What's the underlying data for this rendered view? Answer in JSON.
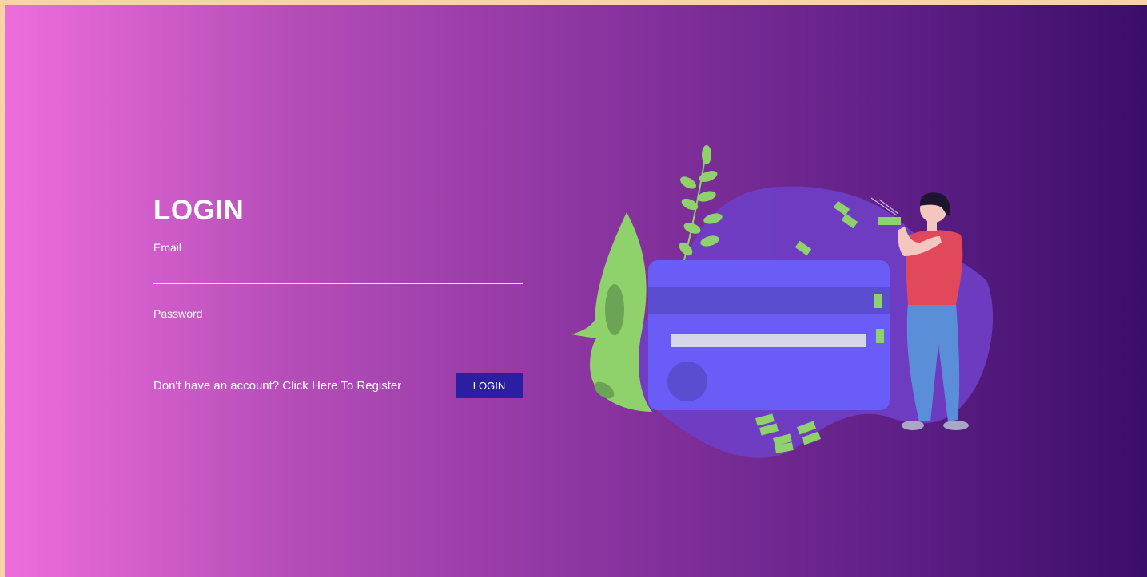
{
  "login": {
    "title": "LOGIN",
    "email_label": "Email",
    "email_value": "",
    "password_label": "Password",
    "password_value": "",
    "register_text": "Don't have an account? Click Here To Register",
    "submit_label": "LOGIN"
  },
  "colors": {
    "gradient_start": "#ee6ddd",
    "gradient_end": "#3b0e6a",
    "page_border": "#f8d3a6",
    "button": "#2a1fa0",
    "card": "#6a5cf6",
    "card_stripe": "#5a4dd0",
    "blob": "#6f3fc6",
    "leaf": "#8fd16a",
    "shirt": "#e1485a",
    "jeans": "#5b8ed8"
  },
  "icons": {
    "illustration": "credit-card-payment-illustration"
  }
}
